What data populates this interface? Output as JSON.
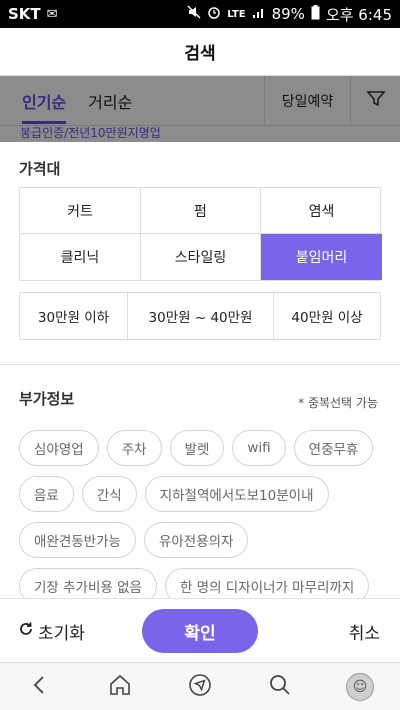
{
  "status_bar": {
    "carrier": "SKT",
    "network": "LTE",
    "battery": "89%",
    "time": "오후 6:45"
  },
  "header": {
    "title": "검색"
  },
  "background": {
    "tabs": [
      {
        "label": "인기순",
        "active": true
      },
      {
        "label": "거리순",
        "active": false
      }
    ],
    "reserve_label": "당일예약",
    "snippet": "봉급인증/전년10만원지명업"
  },
  "price_section": {
    "title": "가격대"
  },
  "services": [
    {
      "label": "커트",
      "selected": false
    },
    {
      "label": "펌",
      "selected": false
    },
    {
      "label": "염색",
      "selected": false
    },
    {
      "label": "클리닉",
      "selected": false
    },
    {
      "label": "스타일링",
      "selected": false
    },
    {
      "label": "붙임머리",
      "selected": true
    }
  ],
  "price_ranges": [
    "30만원 이하",
    "30만원 ~ 40만원",
    "40만원 이상"
  ],
  "extra_section": {
    "title": "부가정보",
    "note": "* 중복선택 가능"
  },
  "chips": [
    [
      "심야영업",
      "주차",
      "발렛",
      "wifi",
      "연중무휴"
    ],
    [
      "음료",
      "간식",
      "지하철역에서도보10분이내"
    ],
    [
      "애완견동반가능",
      "유아전용의자"
    ],
    [
      "기장 추가비용 없음",
      "한 명의 디자이너가 마무리까지"
    ]
  ],
  "actions": {
    "reset_label": "초기화",
    "confirm_label": "확인",
    "cancel_label": "취소"
  },
  "colors": {
    "accent": "#7b63ea",
    "accent_text": "#6b4ee6"
  }
}
